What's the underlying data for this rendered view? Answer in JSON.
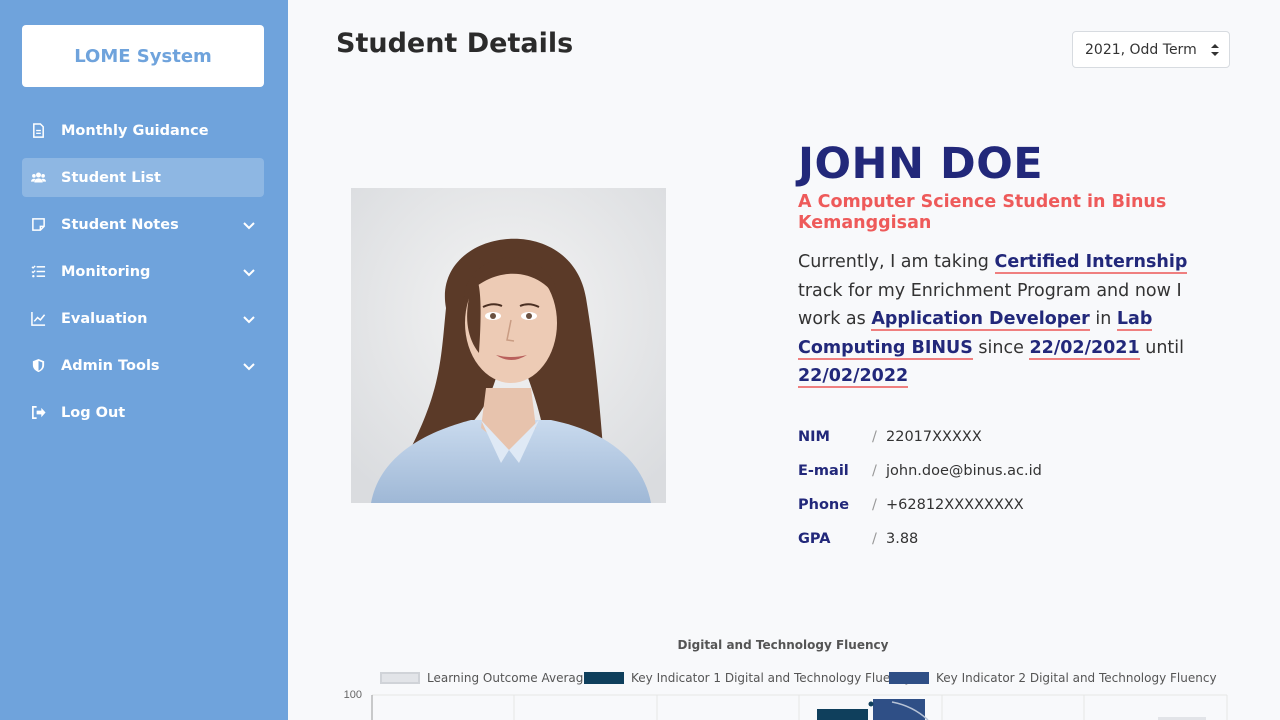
{
  "sidebar": {
    "brand": "LOME System",
    "items": [
      {
        "label": "Monthly Guidance",
        "icon": "document-icon",
        "expandable": false,
        "active": false
      },
      {
        "label": "Student List",
        "icon": "users-icon",
        "expandable": false,
        "active": true
      },
      {
        "label": "Student Notes",
        "icon": "note-icon",
        "expandable": true,
        "active": false
      },
      {
        "label": "Monitoring",
        "icon": "tasks-icon",
        "expandable": true,
        "active": false
      },
      {
        "label": "Evaluation",
        "icon": "line-chart-icon",
        "expandable": true,
        "active": false
      },
      {
        "label": "Admin Tools",
        "icon": "shield-icon",
        "expandable": true,
        "active": false
      },
      {
        "label": "Log Out",
        "icon": "logout-icon",
        "expandable": false,
        "active": false
      }
    ]
  },
  "header": {
    "title": "Student Details",
    "term_select": "2021, Odd Term"
  },
  "profile": {
    "name": "JOHN DOE",
    "subtitle": "A Computer Science Student in Binus Kemanggisan",
    "desc_1": "Currently, I am taking",
    "track": "Certified Internship",
    "desc_2": "track for my Enrichment Program and now I work as",
    "position": "Application Developer",
    "desc_3": "in",
    "company": "Lab Computing BINUS",
    "desc_4": "since",
    "start_date": "22/02/2021",
    "desc_5": "until",
    "end_date": "22/02/2022"
  },
  "details": {
    "sep": "/",
    "rows": [
      {
        "key": "NIM",
        "value": "22017XXXXX"
      },
      {
        "key": "E-mail",
        "value": "john.doe@binus.ac.id"
      },
      {
        "key": "Phone",
        "value": "+62812XXXXXXXX"
      },
      {
        "key": "GPA",
        "value": "3.88"
      }
    ]
  },
  "colors": {
    "sidebar": "#6fa3dc",
    "accent_navy": "#22287a",
    "accent_red": "#ee5a5a",
    "series_avg": "#e2e4e8",
    "series_ki1": "#0f3f5c",
    "series_ki2": "#2f4f86"
  },
  "chart_data": {
    "type": "bar",
    "title": "Digital and Technology Fluency",
    "series": [
      {
        "name": "Learning Outcome Average"
      },
      {
        "name": "Key Indicator 1 Digital and Technology Fluency"
      },
      {
        "name": "Key Indicator 2 Digital and Technology Fluency"
      }
    ],
    "y_tick_top": "100"
  }
}
